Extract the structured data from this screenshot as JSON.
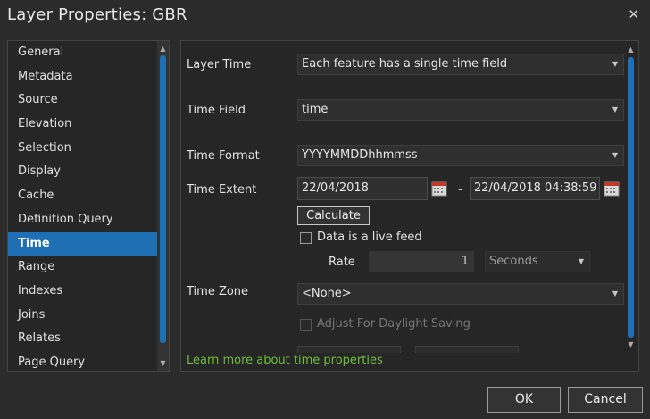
{
  "window": {
    "title": "Layer Properties: GBR",
    "close_glyph": "✕"
  },
  "sidebar": {
    "items": [
      {
        "label": "General"
      },
      {
        "label": "Metadata"
      },
      {
        "label": "Source"
      },
      {
        "label": "Elevation"
      },
      {
        "label": "Selection"
      },
      {
        "label": "Display"
      },
      {
        "label": "Cache"
      },
      {
        "label": "Definition Query"
      },
      {
        "label": "Time"
      },
      {
        "label": "Range"
      },
      {
        "label": "Indexes"
      },
      {
        "label": "Joins"
      },
      {
        "label": "Relates"
      },
      {
        "label": "Page Query"
      }
    ],
    "active": "Time"
  },
  "time": {
    "layer_time_label": "Layer Time",
    "layer_time_value": "Each feature has a single time field",
    "time_field_label": "Time Field",
    "time_field_value": "time",
    "time_format_label": "Time Format",
    "time_format_value": "YYYYMMDDhhmmss",
    "time_extent_label": "Time Extent",
    "extent_start": "22/04/2018",
    "extent_sep": "-",
    "extent_end": "22/04/2018 04:38:59",
    "calculate_label": "Calculate",
    "live_feed_label": "Data is a live feed",
    "rate_label": "Rate",
    "rate_value": "1",
    "rate_unit": "Seconds",
    "time_zone_label": "Time Zone",
    "time_zone_value": "<None>",
    "dst_label": "Adjust For Daylight Saving",
    "learn_more": "Learn more about time properties"
  },
  "footer": {
    "ok_label": "OK",
    "cancel_label": "Cancel"
  },
  "colors": {
    "accent": "#1f6fb4",
    "link": "#6dbd3c",
    "background": "#2b2b2b"
  },
  "icons": {
    "calendar": "calendar-icon",
    "close": "close-icon",
    "caret": "chevron-down-icon"
  }
}
